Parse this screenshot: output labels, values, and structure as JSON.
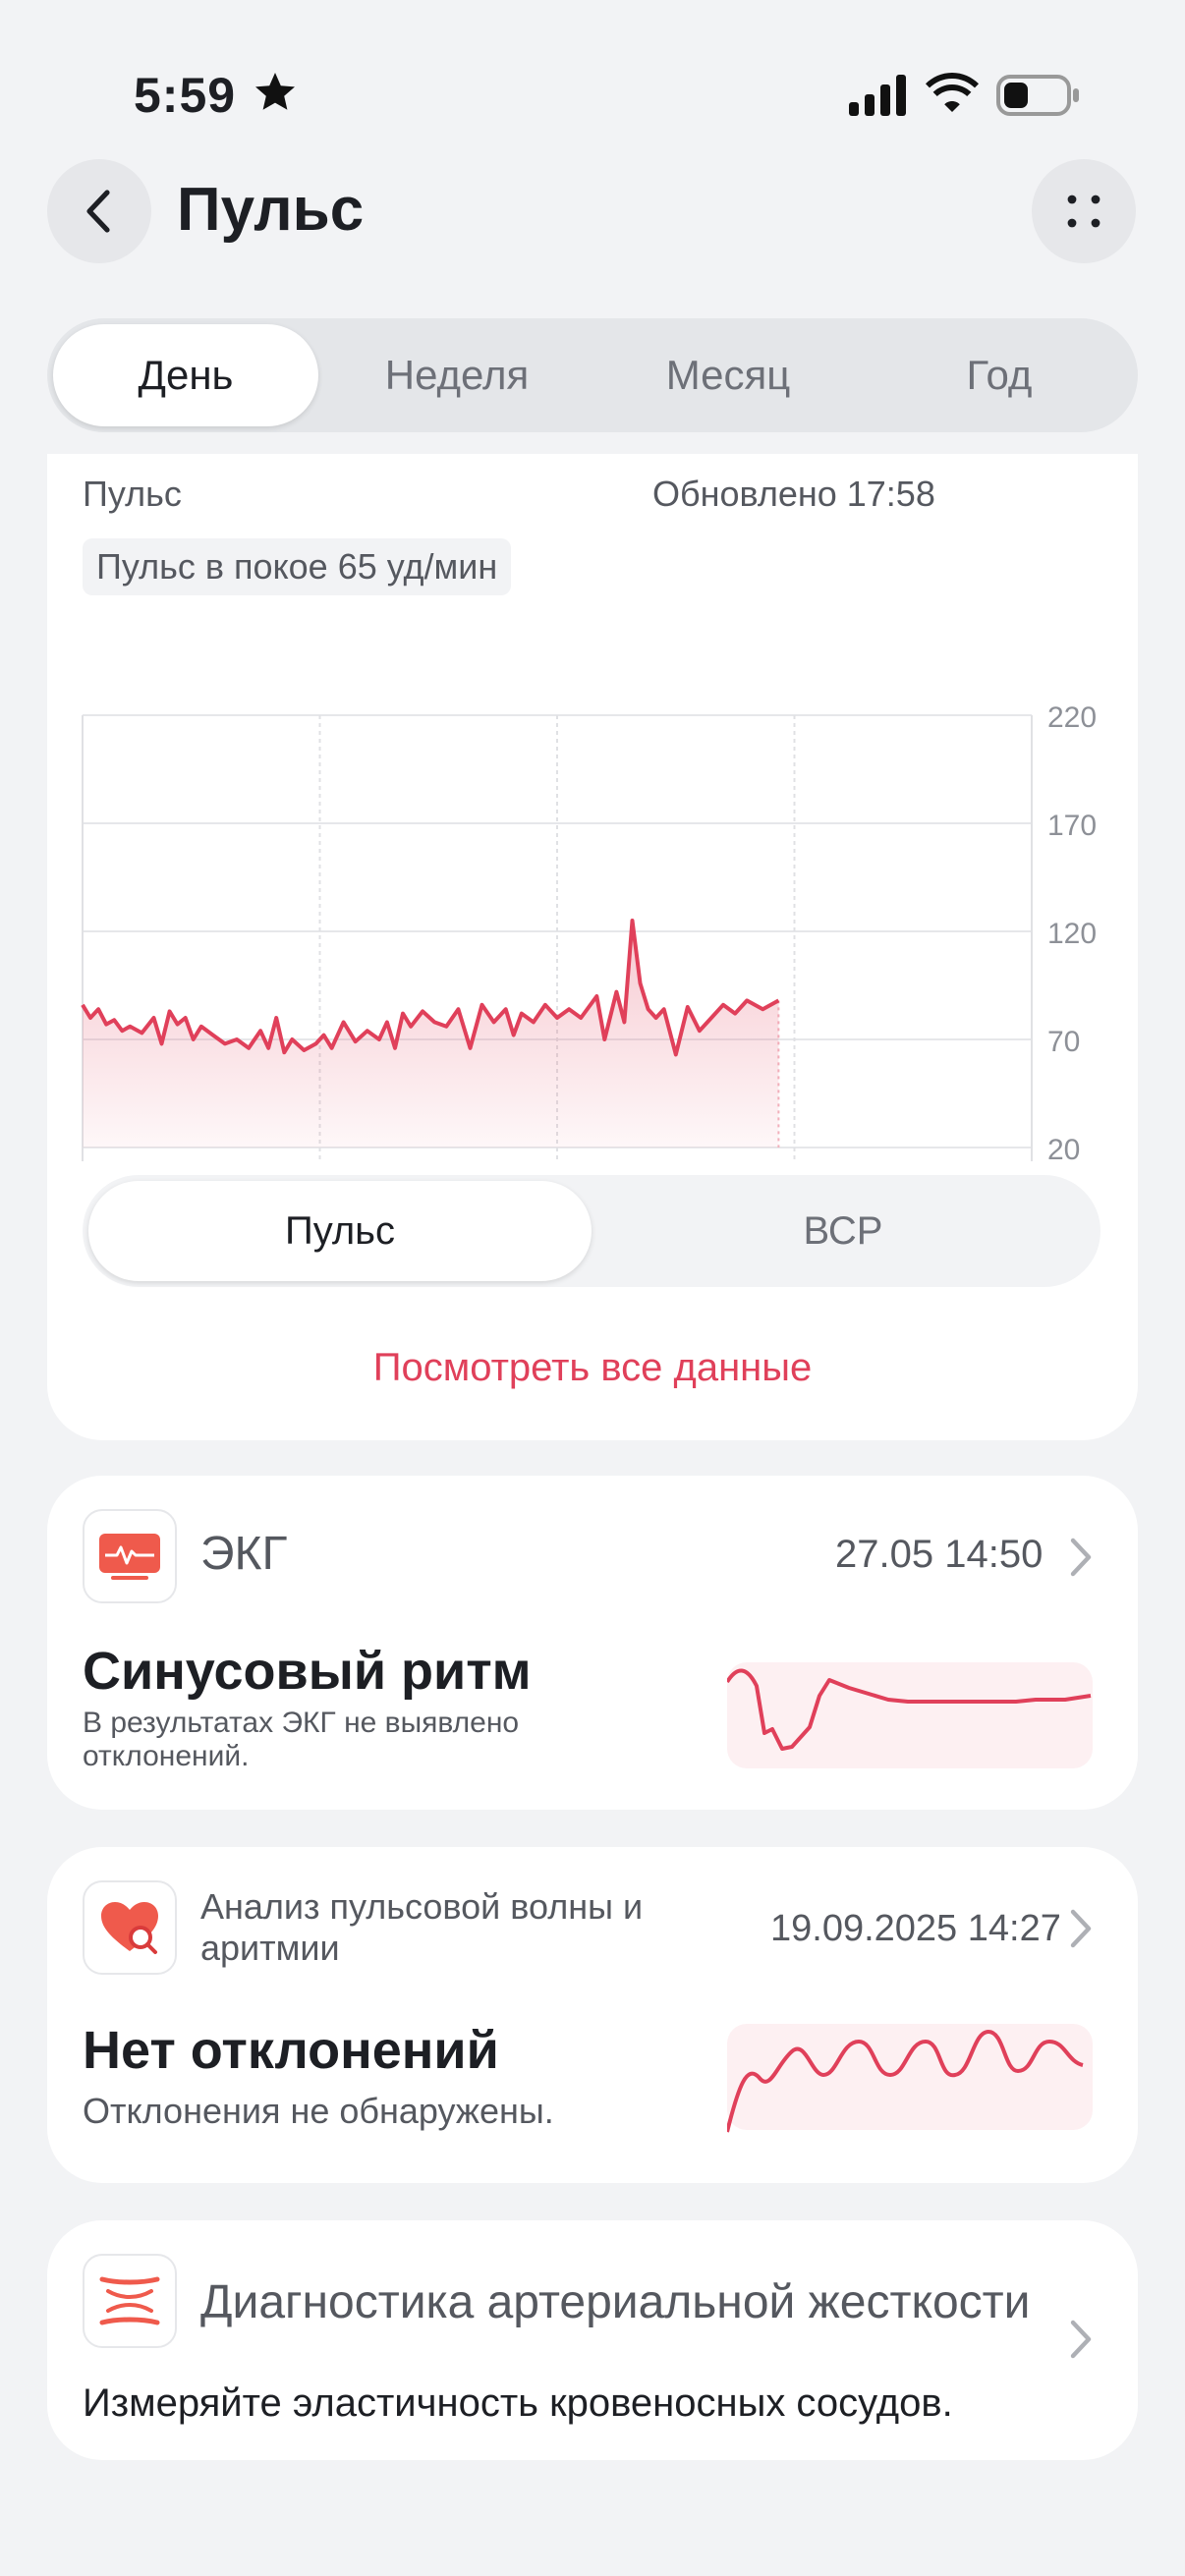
{
  "status_bar": {
    "time": "5:59"
  },
  "header": {
    "title": "Пульс"
  },
  "periods": [
    {
      "label": "День",
      "active": true
    },
    {
      "label": "Неделя",
      "active": false
    },
    {
      "label": "Месяц",
      "active": false
    },
    {
      "label": "Год",
      "active": false
    }
  ],
  "heart_card": {
    "label": "Пульс",
    "updated": "Обновлено 17:58",
    "resting": "Пульс в покое 65 уд/мин",
    "segments": [
      {
        "label": "Пульс",
        "active": true
      },
      {
        "label": "ВСР",
        "active": false
      }
    ],
    "view_all": "Посмотреть все данные"
  },
  "chart_data": {
    "type": "line",
    "x_ticks": [
      "00:00",
      "06:00",
      "12:00",
      "18:00"
    ],
    "xlim": [
      0,
      24
    ],
    "y_ticks": [
      "220",
      "170",
      "120",
      "70",
      "20"
    ],
    "ylim": [
      20,
      220
    ],
    "grid": true,
    "series_color": "#e0405a",
    "x": [
      0,
      0.2,
      0.4,
      0.6,
      0.8,
      1.0,
      1.2,
      1.5,
      1.8,
      2.0,
      2.2,
      2.4,
      2.6,
      2.8,
      3.0,
      3.3,
      3.6,
      3.9,
      4.2,
      4.5,
      4.7,
      4.9,
      5.1,
      5.3,
      5.6,
      5.9,
      6.1,
      6.3,
      6.6,
      6.9,
      7.2,
      7.5,
      7.7,
      7.9,
      8.1,
      8.3,
      8.6,
      8.9,
      9.2,
      9.5,
      9.8,
      10.1,
      10.4,
      10.7,
      10.9,
      11.1,
      11.4,
      11.7,
      12.0,
      12.3,
      12.6,
      13.0,
      13.2,
      13.5,
      13.7,
      13.9,
      14.1,
      14.3,
      14.5,
      14.7,
      15.0,
      15.3,
      15.6,
      15.9,
      16.2,
      16.5,
      16.8,
      17.2,
      17.6
    ],
    "values": [
      86,
      80,
      84,
      77,
      79,
      74,
      76,
      73,
      80,
      68,
      83,
      77,
      80,
      70,
      76,
      72,
      68,
      70,
      66,
      74,
      66,
      80,
      64,
      70,
      65,
      68,
      72,
      66,
      78,
      69,
      74,
      70,
      78,
      66,
      82,
      76,
      83,
      78,
      76,
      84,
      66,
      86,
      78,
      84,
      72,
      82,
      78,
      86,
      80,
      84,
      80,
      90,
      70,
      92,
      78,
      125,
      96,
      84,
      80,
      84,
      63,
      85,
      74,
      80,
      86,
      82,
      88,
      84,
      88
    ]
  },
  "ecg_card": {
    "name": "ЭКГ",
    "date": "27.05 14:50",
    "result": "Синусовый ритм",
    "description_line1": "В результатах ЭКГ не выявлено",
    "description_line2": "отклонений."
  },
  "pwa_card": {
    "name_line1": "Анализ пульсовой волны и",
    "name_line2": "аритмии",
    "date": "19.09.2025 14:27",
    "result": "Нет отклонений",
    "description": "Отклонения не обнаружены."
  },
  "arterial_card": {
    "name": "Диагностика артериальной жесткости",
    "description": "Измеряйте эластичность кровеносных сосудов."
  },
  "colors": {
    "accent": "#e0405a",
    "background": "#f2f3f5",
    "card": "#ffffff"
  }
}
